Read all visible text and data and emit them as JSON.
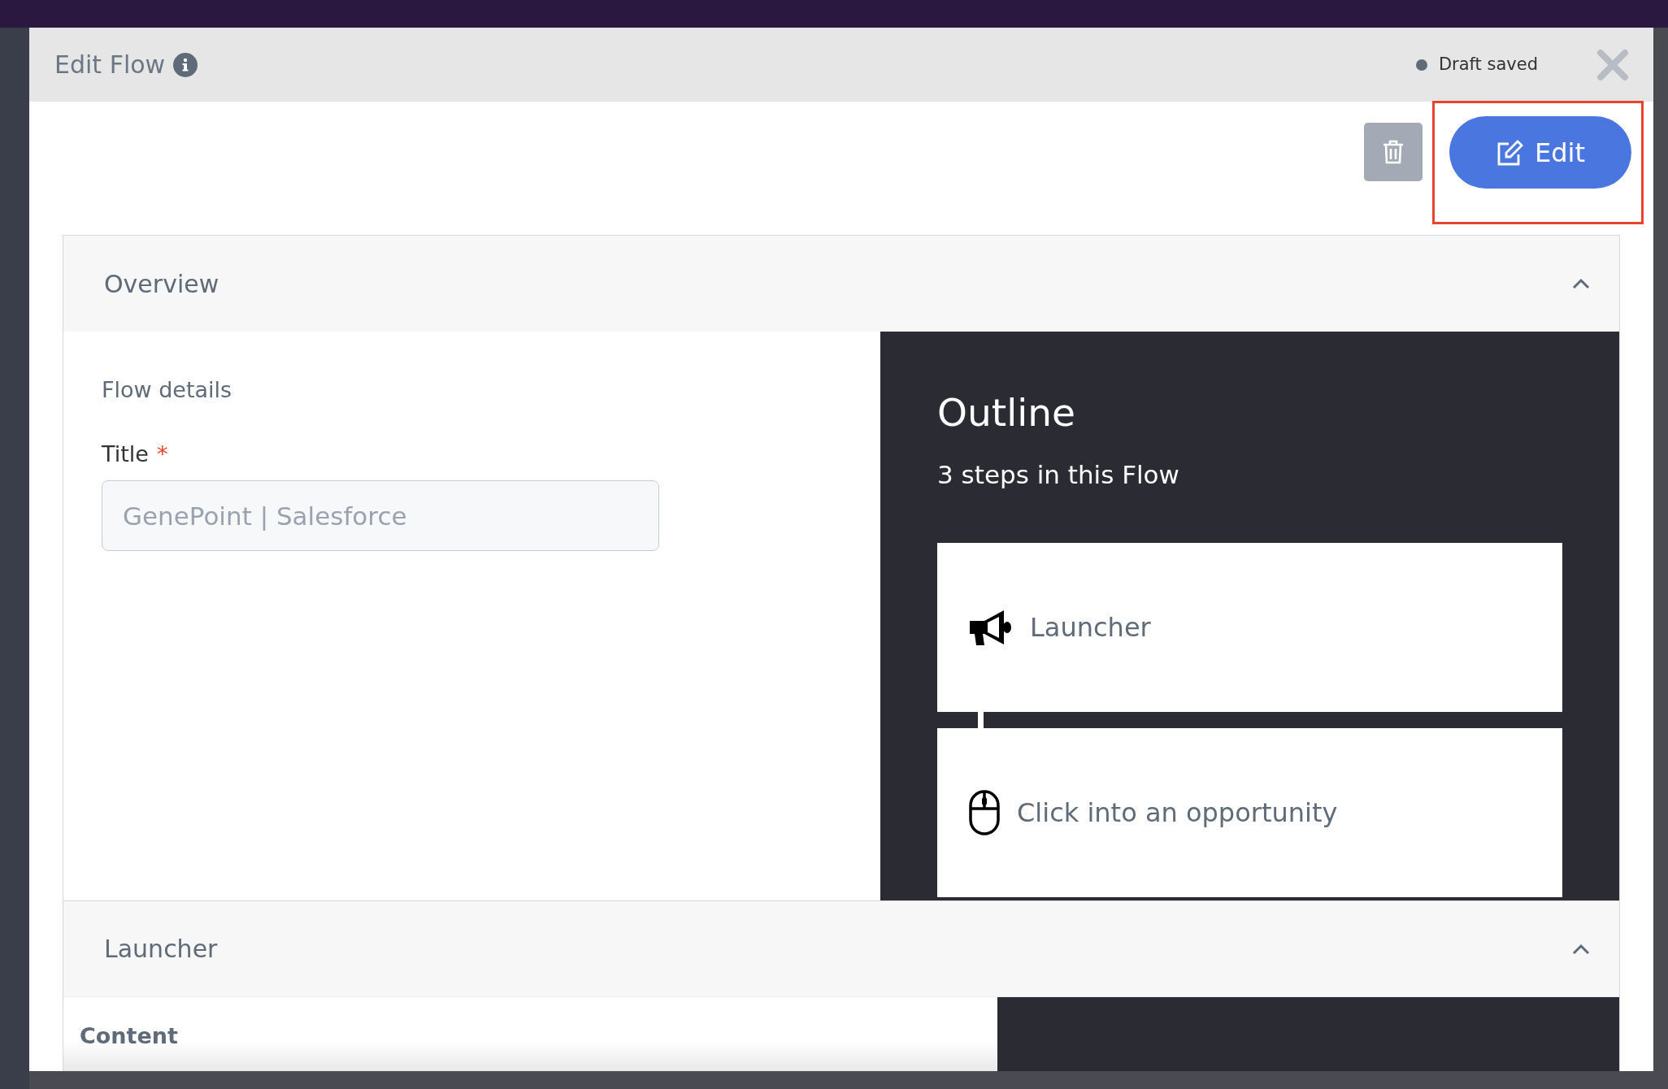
{
  "modal": {
    "title": "Edit Flow",
    "save_status": "Draft saved"
  },
  "toolbar": {
    "edit_button": "Edit",
    "edit_highlighted": true
  },
  "sections": [
    {
      "kind": "overview",
      "title": "Overview",
      "expanded": true,
      "details_heading": "Flow details",
      "field_label": "Title",
      "required_mark": "*",
      "field_value": "GenePoint | Salesforce",
      "outline_title": "Outline",
      "outline_subtitle": "3 steps in this Flow",
      "steps": [
        {
          "kind": "launcher",
          "label": "Launcher"
        },
        {
          "kind": "click",
          "label": "Click into an opportunity"
        }
      ]
    },
    {
      "kind": "launcher",
      "title": "Launcher",
      "expanded": true,
      "content_heading": "Content"
    }
  ]
}
